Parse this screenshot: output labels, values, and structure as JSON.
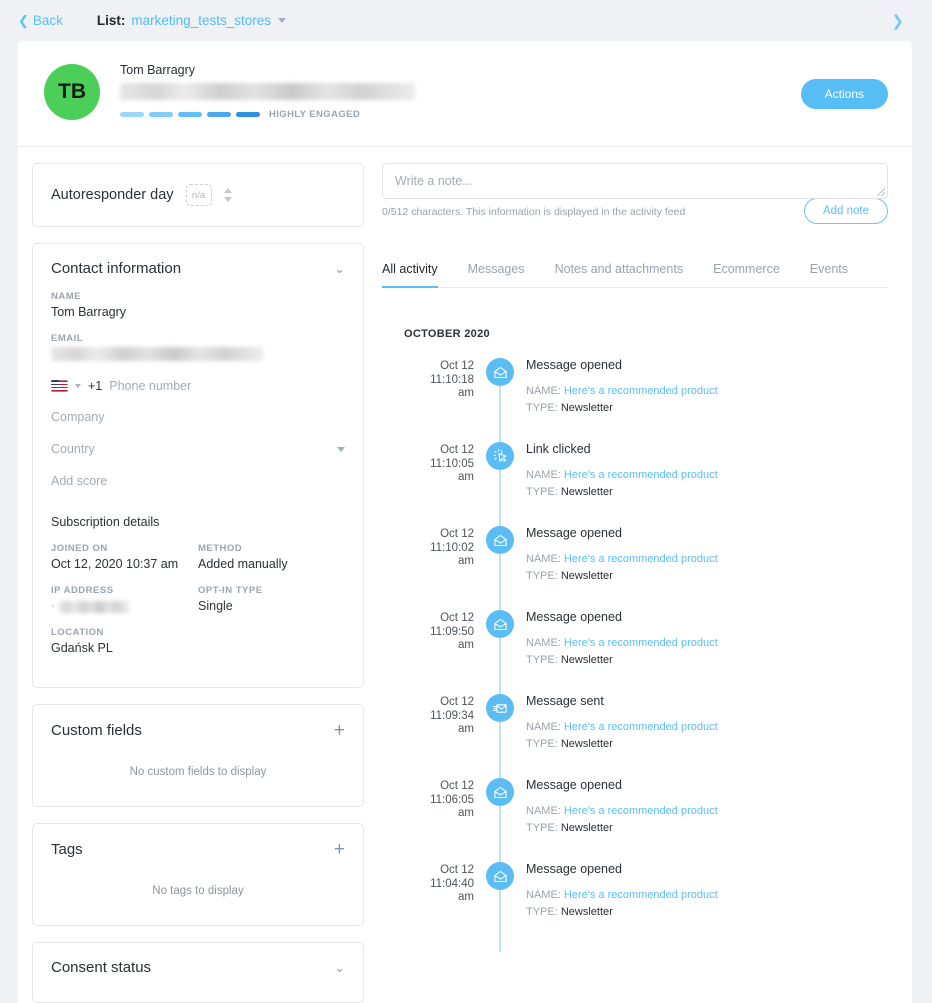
{
  "topbar": {
    "back_label": "Back",
    "back_icon": "chevron-left-icon",
    "list_label": "List:",
    "list_value": "marketing_tests_stores",
    "next_icon": "chevron-right-icon"
  },
  "profile": {
    "initials": "TB",
    "name": "Tom Barragry",
    "email_redacted": true,
    "engagement_label": "HIGHLY ENGAGED",
    "engagement_bars": [
      "#9ad8fa",
      "#7fcdf8",
      "#63bef5",
      "#4aa9ee",
      "#2f8fe0"
    ],
    "actions_label": "Actions",
    "avatar_color": "#4ccf58",
    "accent_color": "#56bdf5"
  },
  "autoresponder": {
    "label": "Autoresponder day",
    "value": "n/a",
    "stepper_up_icon": "caret-up-icon",
    "stepper_down_icon": "caret-down-icon"
  },
  "contact_information": {
    "title": "Contact information",
    "collapse_icon": "chevron-down-icon",
    "name_label": "NAME",
    "name_value": "Tom Barragry",
    "email_label": "EMAIL",
    "email_value": "",
    "phone_dial": "+1",
    "phone_placeholder": "Phone number",
    "flag_icon": "us-flag-icon",
    "company_placeholder": "Company",
    "country_placeholder": "Country",
    "country_caret_icon": "caret-down-icon",
    "score_placeholder": "Add score",
    "subscription_title": "Subscription details",
    "details": [
      {
        "label": "JOINED ON",
        "value": "Oct 12, 2020 10:37 am"
      },
      {
        "label": "METHOD",
        "value": "Added manually"
      },
      {
        "label": "IP ADDRESS",
        "value": "",
        "redacted": true
      },
      {
        "label": "OPT-IN TYPE",
        "value": "Single"
      },
      {
        "label": "LOCATION",
        "value": "Gdańsk PL"
      }
    ]
  },
  "custom_fields": {
    "title": "Custom fields",
    "add_icon": "plus-icon",
    "empty_text": "No custom fields to display"
  },
  "tags": {
    "title": "Tags",
    "add_icon": "plus-icon",
    "empty_text": "No tags to display"
  },
  "consent_status": {
    "title": "Consent status",
    "collapse_icon": "chevron-down-icon"
  },
  "note_composer": {
    "placeholder": "Write a note...",
    "value": "",
    "char_counter": "0/512 characters. This information is displayed in the activity feed",
    "add_button_label": "Add note",
    "resize_icon": "resize-grip-icon"
  },
  "activity": {
    "tabs": [
      {
        "label": "All activity",
        "active": true
      },
      {
        "label": "Messages",
        "active": false
      },
      {
        "label": "Notes and attachments",
        "active": false
      },
      {
        "label": "Ecommerce",
        "active": false
      },
      {
        "label": "Events",
        "active": false
      }
    ],
    "month_header": "OCTOBER 2020",
    "name_key": "NAME:",
    "type_key": "TYPE:",
    "items": [
      {
        "date": "Oct 12",
        "time": "11:10:18",
        "meridiem": "am",
        "title": "Message opened",
        "icon": "envelope-open-icon",
        "name": "Here's a recommended product",
        "type": "Newsletter"
      },
      {
        "date": "Oct 12",
        "time": "11:10:05",
        "meridiem": "am",
        "title": "Link clicked",
        "icon": "cursor-click-icon",
        "name": "Here's a recommended product",
        "type": "Newsletter"
      },
      {
        "date": "Oct 12",
        "time": "11:10:02",
        "meridiem": "am",
        "title": "Message opened",
        "icon": "envelope-open-icon",
        "name": "Here's a recommended product",
        "type": "Newsletter"
      },
      {
        "date": "Oct 12",
        "time": "11:09:50",
        "meridiem": "am",
        "title": "Message opened",
        "icon": "envelope-open-icon",
        "name": "Here's a recommended product",
        "type": "Newsletter"
      },
      {
        "date": "Oct 12",
        "time": "11:09:34",
        "meridiem": "am",
        "title": "Message sent",
        "icon": "envelope-send-icon",
        "name": "Here's a recommended product",
        "type": "Newsletter"
      },
      {
        "date": "Oct 12",
        "time": "11:06:05",
        "meridiem": "am",
        "title": "Message opened",
        "icon": "envelope-open-icon",
        "name": "Here's a recommended product",
        "type": "Newsletter"
      },
      {
        "date": "Oct 12",
        "time": "11:04:40",
        "meridiem": "am",
        "title": "Message opened",
        "icon": "envelope-open-icon",
        "name": "Here's a recommended product",
        "type": "Newsletter"
      }
    ]
  }
}
